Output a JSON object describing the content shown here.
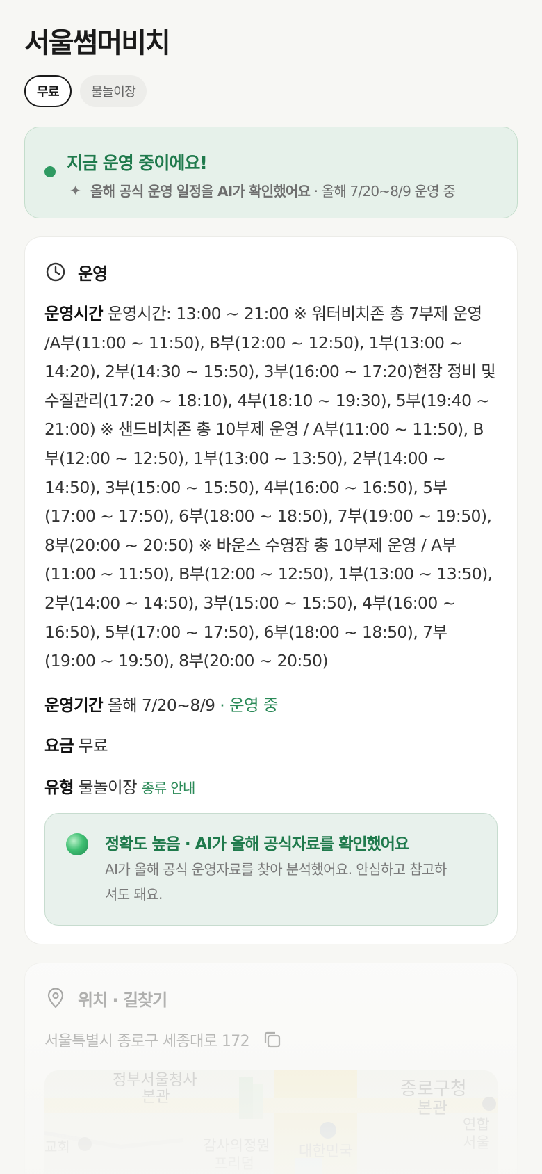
{
  "title": "서울썸머비치",
  "chips": [
    {
      "label": "무료",
      "active": true
    },
    {
      "label": "물놀이장",
      "active": false
    }
  ],
  "status": {
    "title": "지금 운영 중이에요!",
    "ai_note": "올해 공식 운영 일정을 AI가 확인했어요",
    "period_note": "· 올해 7/20~8/9 운영 중"
  },
  "operation": {
    "heading": "운영",
    "hours_label": "운영시간",
    "hours_text": "운영시간: 13:00 ~ 21:00 ※ 워터비치존 총 7부제 운영 /A부(11:00 ~ 11:50), B부(12:00 ~ 12:50), 1부(13:00 ~ 14:20), 2부(14:30 ~ 15:50), 3부(16:00 ~ 17:20)현장 정비 및 수질관리(17:20 ~ 18:10), 4부(18:10 ~ 19:30), 5부(19:40 ~ 21:00) ※ 샌드비치존 총 10부제 운영 / A부(11:00 ~ 11:50), B부(12:00 ~ 12:50), 1부(13:00 ~ 13:50), 2부(14:00 ~ 14:50), 3부(15:00 ~ 15:50), 4부(16:00 ~ 16:50), 5부(17:00 ~ 17:50), 6부(18:00 ~ 18:50), 7부(19:00 ~ 19:50), 8부(20:00 ~ 20:50) ※ 바운스 수영장 총 10부제 운영 / A부(11:00 ~ 11:50), B부(12:00 ~ 12:50), 1부(13:00 ~ 13:50), 2부(14:00 ~ 14:50), 3부(15:00 ~ 15:50), 4부(16:00 ~ 16:50), 5부(17:00 ~ 17:50), 6부(18:00 ~ 18:50), 7부(19:00 ~ 19:50), 8부(20:00 ~ 20:50)",
    "period_label": "운영기간",
    "period_value": "올해 7/20~8/9",
    "period_status": "· 운영 중",
    "fee_label": "요금",
    "fee_value": "무료",
    "type_label": "유형",
    "type_value": "물놀이장",
    "type_link": "종류 안내"
  },
  "accuracy": {
    "title": "정확도 높음 · AI가 올해 공식자료를 확인했어요",
    "desc": "AI가 올해 공식 운영자료를 찾아 분석했어요. 안심하고 참고하셔도 돼요."
  },
  "location": {
    "heading": "위치 · 길찾기",
    "address": "서울특별시 종로구 세종대로 172",
    "map_labels": [
      "정부서울청사",
      "본관",
      "종로구청",
      "본관",
      "연합",
      "서울",
      "교회",
      "감사의정원",
      "프리덤",
      "대한민국"
    ]
  },
  "colors": {
    "accent_green": "#1f7a4c",
    "status_bg": "#e6f1ea",
    "page_bg": "#f7f7f4"
  }
}
